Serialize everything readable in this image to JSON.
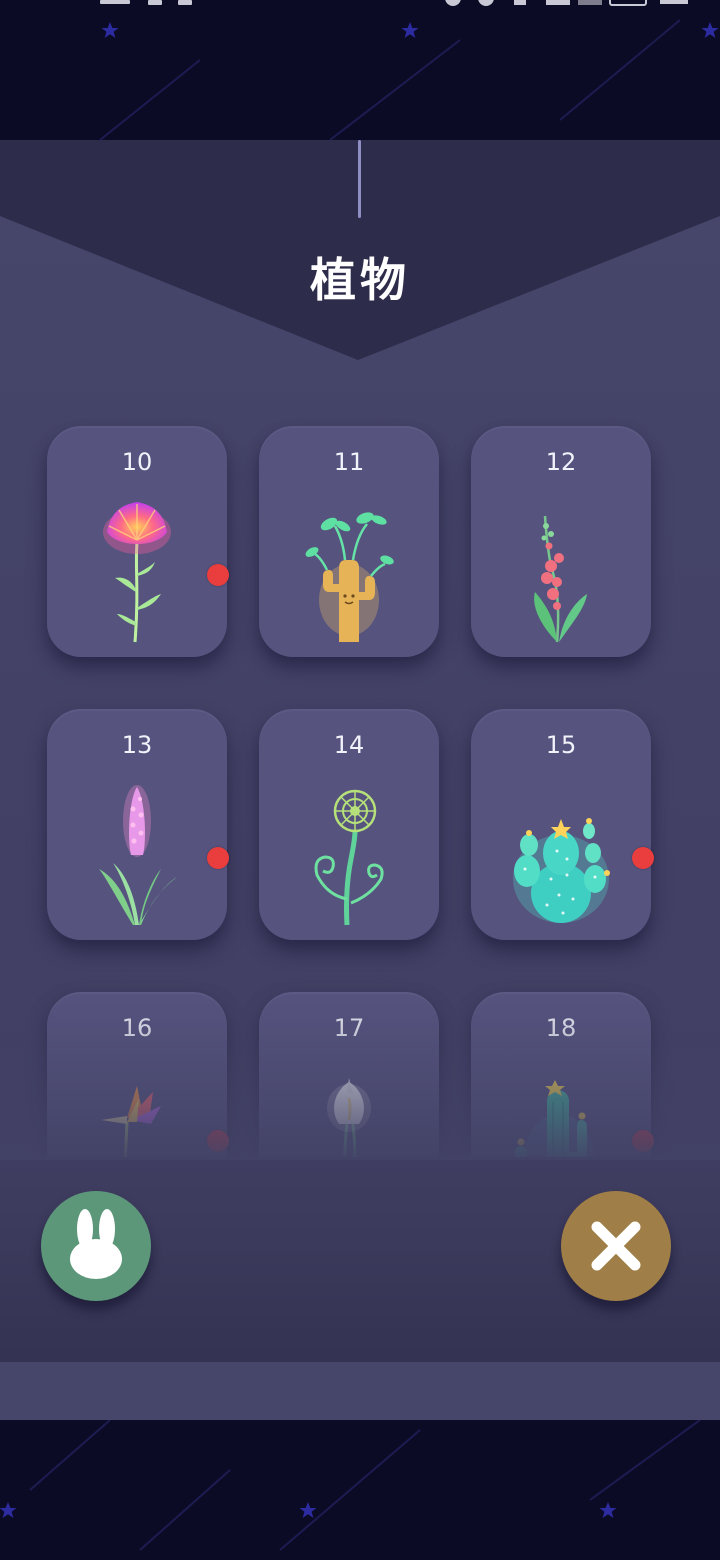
{
  "title": "植物",
  "items": [
    {
      "number": "10",
      "plant": "glowing-dandelion-flower",
      "has_badge": true
    },
    {
      "number": "11",
      "plant": "cactus-with-sprouts",
      "has_badge": false
    },
    {
      "number": "12",
      "plant": "red-blossom-branch",
      "has_badge": false
    },
    {
      "number": "13",
      "plant": "pink-lupine-spike",
      "has_badge": true
    },
    {
      "number": "14",
      "plant": "curly-fern",
      "has_badge": false
    },
    {
      "number": "15",
      "plant": "teal-prickly-pear-cactus",
      "has_badge": true
    },
    {
      "number": "16",
      "plant": "bird-of-paradise",
      "has_badge": true
    },
    {
      "number": "17",
      "plant": "white-calla-lily",
      "has_badge": false
    },
    {
      "number": "18",
      "plant": "tall-saguaro-cactus",
      "has_badge": true
    }
  ],
  "buttons": {
    "left": "bunny-icon",
    "right": "close-icon"
  },
  "colors": {
    "badge": "#ea3d3d",
    "card": "#56547f",
    "panel": "#46466b",
    "bunny_button": "#5c977a",
    "close_button": "#a07e48"
  }
}
